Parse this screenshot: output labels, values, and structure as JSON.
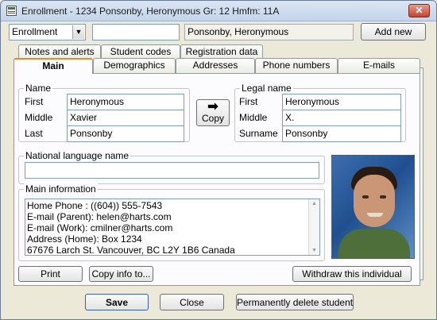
{
  "window": {
    "title": "Enrollment - 1234 Ponsonby, Heronymous Gr: 12 Hmfm: 11A",
    "close_glyph": "✕"
  },
  "toolbar": {
    "mode_select": "Enrollment",
    "search_value": "",
    "name_display": "Ponsonby, Heronymous",
    "add_new_label": "Add new"
  },
  "tabs_back": [
    "Notes and alerts",
    "Student codes",
    "Registration data"
  ],
  "tabs_front": [
    "Main",
    "Demographics",
    "Addresses",
    "Phone numbers",
    "E-mails"
  ],
  "name_group": {
    "label": "Name",
    "first_label": "First",
    "first_value": "Heronymous",
    "middle_label": "Middle",
    "middle_value": "Xavier",
    "last_label": "Last",
    "last_value": "Ponsonby"
  },
  "copy_button": {
    "arrow": "➡",
    "label": "Copy"
  },
  "legal_group": {
    "label": "Legal name",
    "first_label": "First",
    "first_value": "Heronymous",
    "middle_label": "Middle",
    "middle_value": "X.",
    "surname_label": "Surname",
    "surname_value": "Ponsonby"
  },
  "national_group": {
    "label": "National language name",
    "value": ""
  },
  "main_info": {
    "label": "Main information",
    "lines": [
      "Home Phone : ((604)) 555-7543",
      "E-mail (Parent): helen@harts.com",
      "E-mail (Work): cmilner@harts.com",
      "Address (Home): Box 1234",
      "67676 Larch St.   Vancouver, BC  L2Y 1B6   Canada"
    ]
  },
  "panel_buttons": {
    "print": "Print",
    "copy_info": "Copy info to...",
    "withdraw": "Withdraw this individual"
  },
  "footer_buttons": {
    "save": "Save",
    "close": "Close",
    "delete": "Permanently delete student"
  }
}
